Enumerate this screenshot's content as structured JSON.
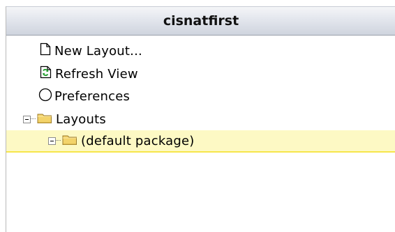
{
  "panel": {
    "title": "cisnatfirst"
  },
  "tree": {
    "actions": [
      {
        "label": "New Layout...",
        "icon": "document-icon"
      },
      {
        "label": "Refresh View",
        "icon": "refresh-icon"
      },
      {
        "label": "Preferences",
        "icon": "circle-icon"
      }
    ],
    "folders": [
      {
        "label": "Layouts",
        "icon": "folder-icon",
        "expanded": true
      },
      {
        "label": "(default package)",
        "icon": "folder-icon",
        "expanded": true,
        "selected": true
      }
    ]
  },
  "colors": {
    "selection_background": "#fdf9c4",
    "selection_underline": "#f6e64b",
    "folder": "#f3d36a"
  }
}
